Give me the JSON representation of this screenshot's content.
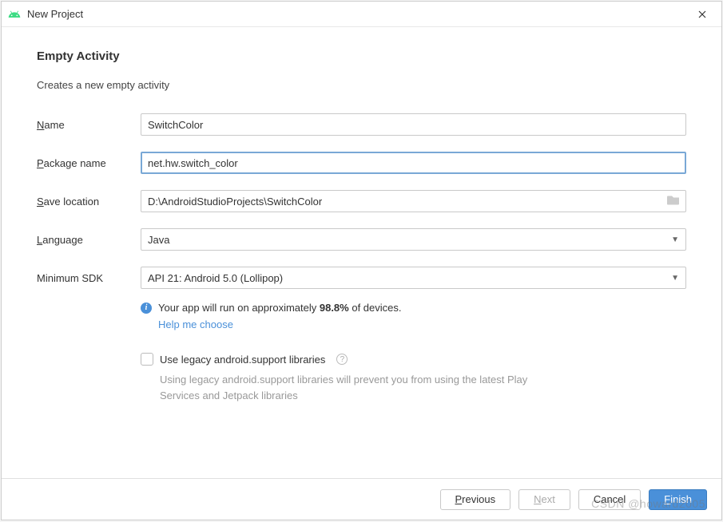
{
  "titlebar": {
    "title": "New Project"
  },
  "heading": "Empty Activity",
  "subheading": "Creates a new empty activity",
  "fields": {
    "name": {
      "label_pre": "N",
      "label_rest": "ame",
      "value": "SwitchColor"
    },
    "package": {
      "label_pre": "P",
      "label_rest": "ackage name",
      "value": "net.hw.switch_color"
    },
    "save": {
      "label_pre": "S",
      "label_rest": "ave location",
      "value": "D:\\AndroidStudioProjects\\SwitchColor"
    },
    "language": {
      "label_pre": "L",
      "label_rest": "anguage",
      "value": "Java"
    },
    "minsdk": {
      "label": "Minimum SDK",
      "value": "API 21: Android 5.0 (Lollipop)"
    }
  },
  "info": {
    "text_pre": "Your app will run on approximately ",
    "percent": "98.8%",
    "text_post": " of devices.",
    "help": "Help me choose"
  },
  "legacy": {
    "label": "Use legacy android.support libraries",
    "desc": "Using legacy android.support libraries will prevent you from using the latest Play Services and Jetpack libraries"
  },
  "buttons": {
    "previous_pre": "P",
    "previous_rest": "revious",
    "next_pre": "N",
    "next_rest": "ext",
    "cancel": "Cancel",
    "finish_pre": "F",
    "finish_rest": "inish"
  },
  "watermark": "CSDN @howard2005"
}
